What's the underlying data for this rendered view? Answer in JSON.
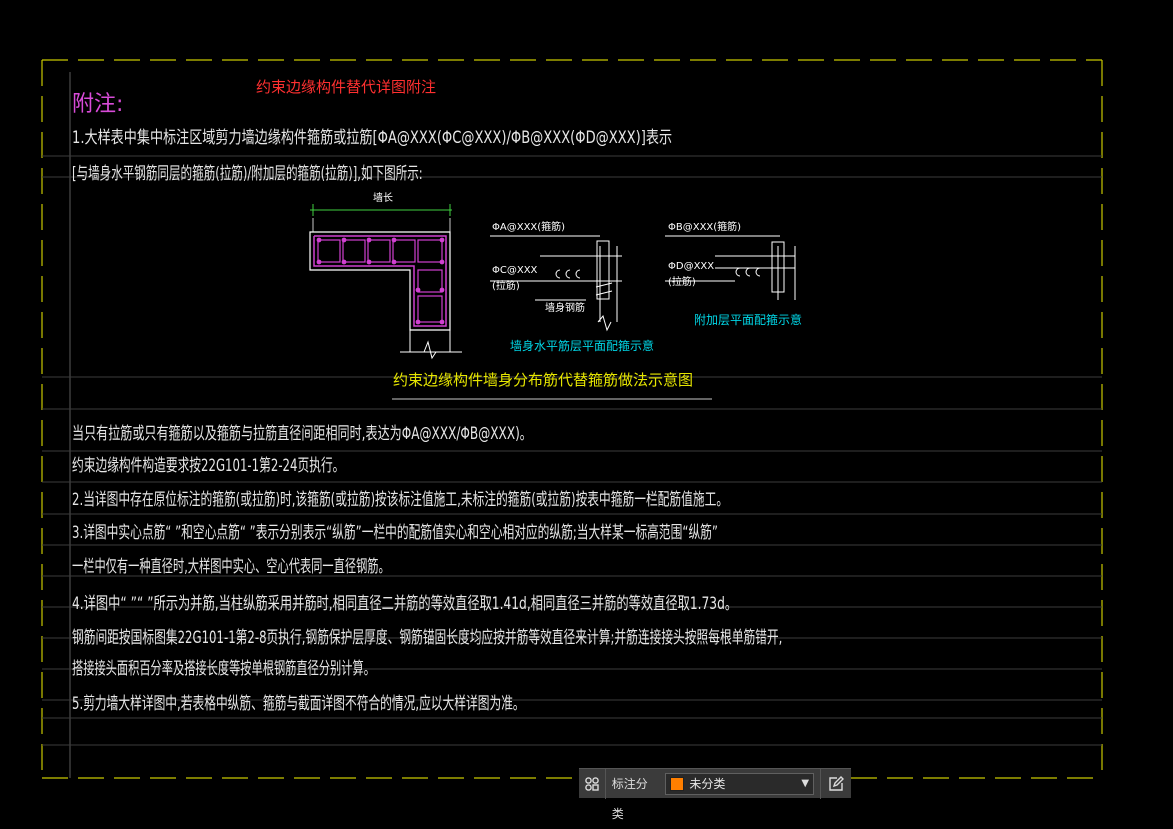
{
  "drawing": {
    "title": "约束边缘构件替代详图附注",
    "heading": "附注:",
    "notes": {
      "n1a": "1.大样表中集中标注区域剪力墙边缘构件箍筋或拉筋[ΦA@XXX(ΦC@XXX)/ΦB@XXX(ΦD@XXX)]表示",
      "n1b": "[与墙身水平钢筋同层的箍筋(拉筋)/附加层的箍筋(拉筋)],如下图所示:",
      "n1c": "当只有拉筋或只有箍筋以及箍筋与拉筋直径间距相同时,表达为ΦA@XXX/ΦB@XXX)。",
      "n1d": "约束边缘构件构造要求按22G101-1第2-24页执行。",
      "n2": "2.当详图中存在原位标注的箍筋(或拉筋)时,该箍筋(或拉筋)按该标注值施工,未标注的箍筋(或拉筋)按表中箍筋一栏配筋值施工。",
      "n3a": "3.详图中实心点筋“ ”和空心点筋“ ”表示分别表示“纵筋”一栏中的配筋值实心和空心相对应的纵筋;当大样某一标高范围“纵筋”",
      "n3b": "一栏中仅有一种直径时,大样图中实心、空心代表同一直径钢筋。",
      "n4a": "4.详图中“ ”“ ”所示为并筋,当柱纵筋采用并筋时,相同直径二并筋的等效直径取1.41d,相同直径三并筋的等效直径取1.73d。",
      "n4b": "钢筋间距按国标图集22G101-1第2-8页执行,钢筋保护层厚度、钢筋锚固长度均应按并筋等效直径来计算;并筋连接接头按照每根单筋错开,",
      "n4c": "搭接接头面积百分率及搭接长度等按单根钢筋直径分别计算。",
      "n5": "5.剪力墙大样详图中,若表格中纵筋、箍筋与截面详图不符合的情况,应以大样详图为准。"
    },
    "diagram": {
      "wall_length_label": "墙长",
      "a_label": "ΦA@XXX(箍筋)",
      "c_label": "ΦC@XXX",
      "c_sub": "(拉筋)",
      "wall_bar_label": "墙身钢筋",
      "b_label": "ΦB@XXX(箍筋)",
      "d_label": "ΦD@XXX",
      "d_sub": "(拉筋)",
      "caption_left": "墙身水平筋层平面配箍示意",
      "caption_right": "附加层平面配箍示意",
      "main_caption": "约束边缘构件墙身分布筋代替箍筋做法示意图"
    },
    "colors": {
      "background": "#000000",
      "border": "#c8c800",
      "note_text": "#e6e6e6",
      "title": "#ff3030",
      "heading": "#d84bd8",
      "caption_cyan": "#00d6e6",
      "caption_yellow": "#e6e600",
      "rebar": "#d040d0"
    }
  },
  "toolbar": {
    "grid_icon": "grid-icon",
    "label": "标注分类",
    "category_value": "未分类",
    "category_color": "#ff7f00",
    "edit_icon": "edit-icon"
  }
}
